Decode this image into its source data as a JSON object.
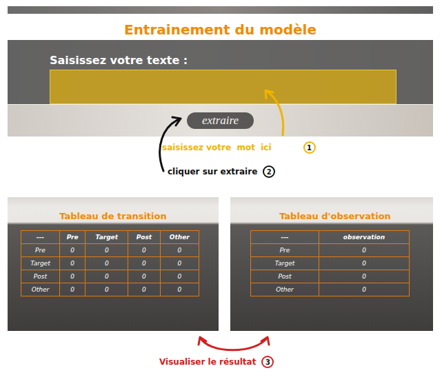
{
  "title": "Entrainement du modèle",
  "input_panel": {
    "label": "Saisissez votre texte :",
    "value": "",
    "button": "extraire"
  },
  "annotations": [
    {
      "number": "1",
      "text": "saisissez votre  mot  ici",
      "color": "#f0b400"
    },
    {
      "number": "2",
      "text": "cliquer sur extraire",
      "color": "#111111"
    },
    {
      "number": "3",
      "text": "Visualiser le résultat",
      "color": "#d42020"
    }
  ],
  "transition_table": {
    "title": "Tableau de transition",
    "columns": [
      "---",
      "Pre",
      "Target",
      "Post",
      "Other"
    ],
    "rows": [
      {
        "label": "Pre",
        "cells": [
          "0",
          "0",
          "0",
          "0"
        ]
      },
      {
        "label": "Target",
        "cells": [
          "0",
          "0",
          "0",
          "0"
        ]
      },
      {
        "label": "Post",
        "cells": [
          "0",
          "0",
          "0",
          "0"
        ]
      },
      {
        "label": "Other",
        "cells": [
          "0",
          "0",
          "0",
          "0"
        ]
      }
    ]
  },
  "observation_table": {
    "title": "Tableau d'observation",
    "columns": [
      "---",
      "observation"
    ],
    "rows": [
      {
        "label": "Pre",
        "cells": [
          "0"
        ]
      },
      {
        "label": "Target",
        "cells": [
          "0"
        ]
      },
      {
        "label": "Post",
        "cells": [
          "0"
        ]
      },
      {
        "label": "Other",
        "cells": [
          "0"
        ]
      }
    ]
  }
}
